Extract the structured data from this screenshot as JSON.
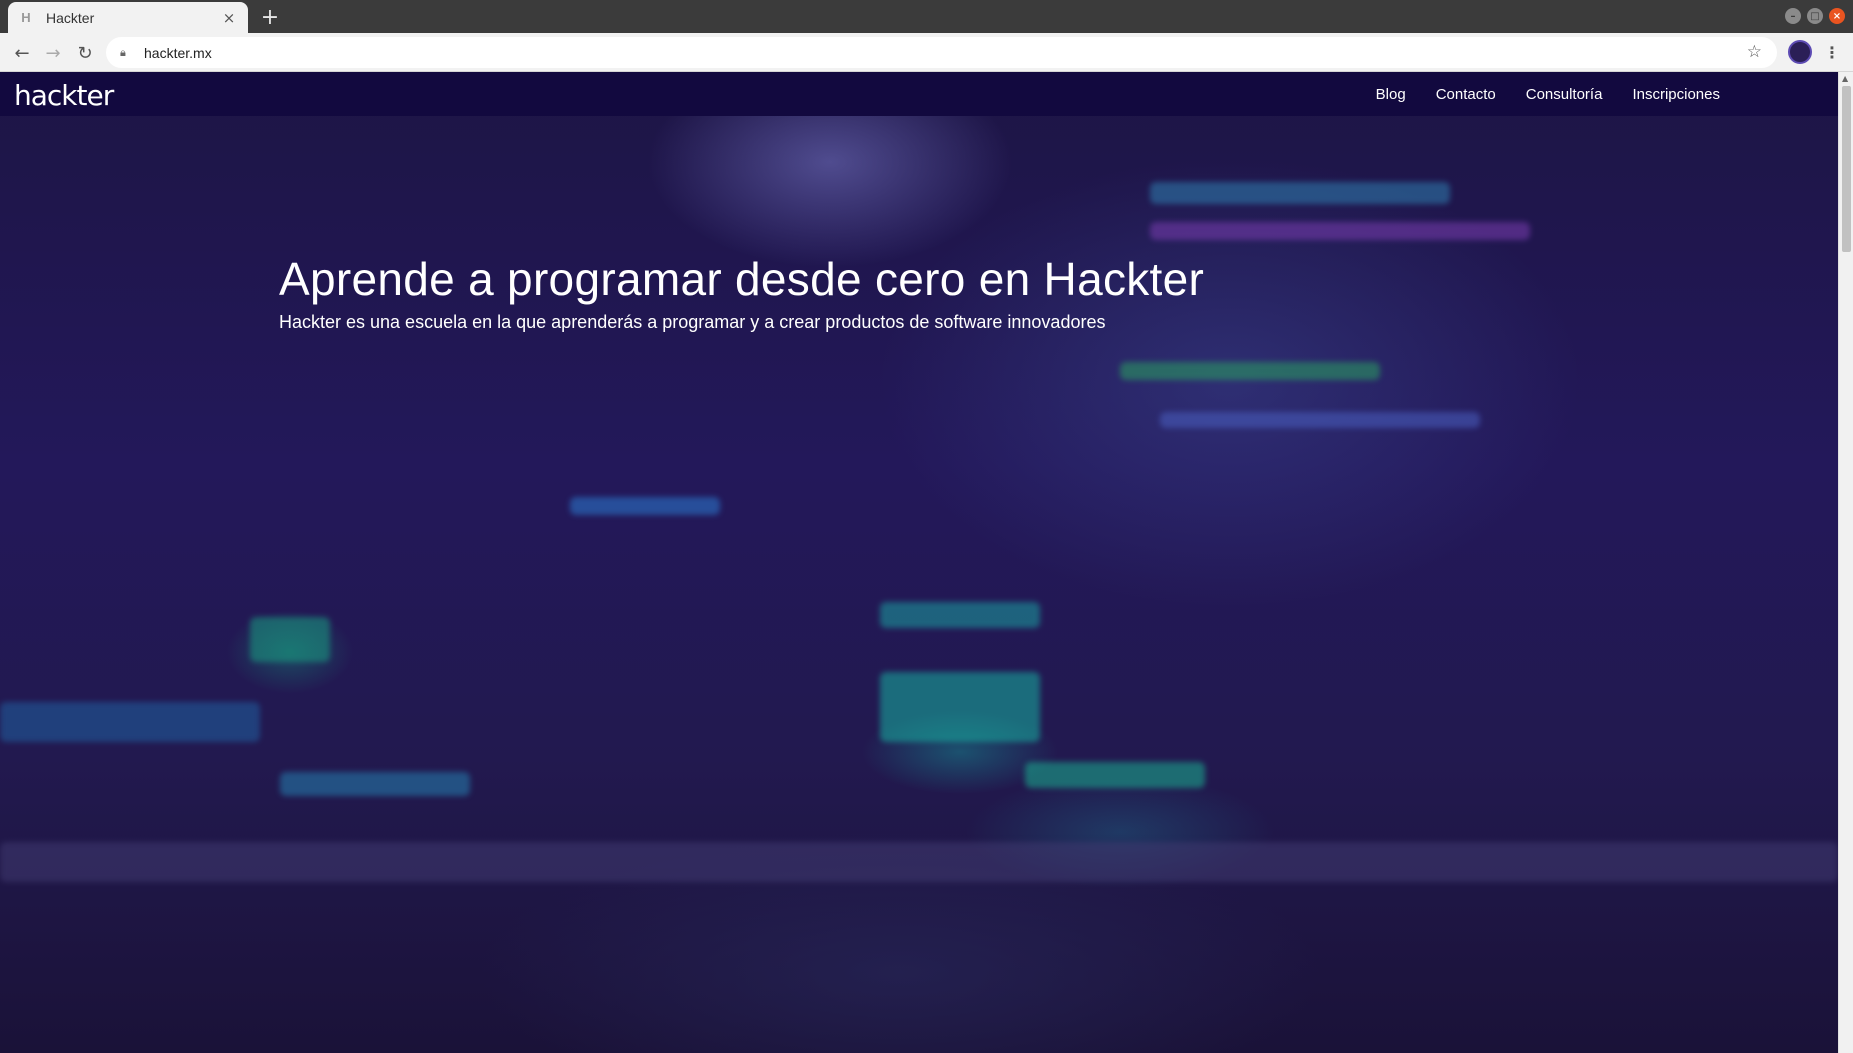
{
  "browser": {
    "tab_title": "Hackter",
    "tab_favicon": "H",
    "tab_close": "×",
    "new_tab": "+",
    "url": "hackter.mx"
  },
  "site": {
    "logo": "hackter",
    "nav": {
      "blog": "Blog",
      "contacto": "Contacto",
      "consultoria": "Consultoría",
      "inscripciones": "Inscripciones"
    }
  },
  "hero": {
    "title": "Aprende a programar desde cero en Hackter",
    "subtitle": "Hackter es una escuela en la que aprenderás a programar y a crear productos de software innovadores"
  },
  "colors": {
    "nav_background": "#12093f",
    "page_overlay": "#1d1545",
    "text": "#ffffff"
  }
}
